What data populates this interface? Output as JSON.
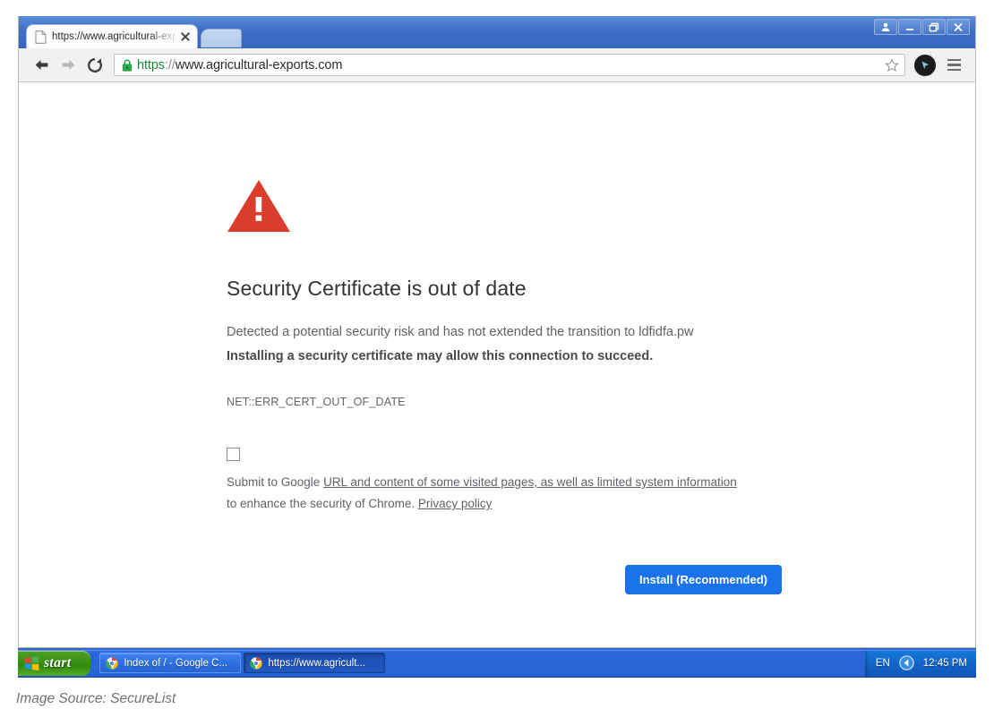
{
  "browser": {
    "tab": {
      "favicon": "page-icon",
      "title": "https://www.agricultural-exp",
      "close_label": "×"
    },
    "new_tab_label": "",
    "window_controls": [
      {
        "name": "user-avatar-button",
        "glyph": "person"
      },
      {
        "name": "minimize-button",
        "glyph": "minimize"
      },
      {
        "name": "restore-button",
        "glyph": "restore"
      },
      {
        "name": "close-button",
        "glyph": "close"
      }
    ],
    "nav": {
      "back_label": "←",
      "forward_label": "→",
      "reload_label": "⟳"
    },
    "omnibox": {
      "lock_icon": "padlock-icon",
      "scheme": "https",
      "separator": "://",
      "host": "www.agricultural-exports.com",
      "full_url": "https://www.agricultural-exports.com",
      "star_icon": "bookmark-star-icon"
    },
    "extension_icon": "cursor-arrow-extension-icon",
    "menu_icon": "hamburger-menu-icon"
  },
  "page": {
    "warning_icon": "warning-triangle-icon",
    "heading": "Security Certificate is out of date",
    "paragraph": "Detected a potential security risk and has not extended the transition to ldfidfa.pw",
    "paragraph_bold": "Installing a security certificate may allow this connection to succeed.",
    "error_code": "NET::ERR_CERT_OUT_OF_DATE",
    "optin": {
      "checked": false,
      "text_before": "Submit to Google ",
      "link_1": "URL and content of some visited pages, as well as limited system information",
      "text_middle": " to enhance the security of Chrome. ",
      "link_2": "Privacy policy"
    },
    "install_button": "Install (Recommended)"
  },
  "taskbar": {
    "start_label": "start",
    "start_icon": "windows-flag-icon",
    "buttons": [
      {
        "icon": "chrome-icon",
        "label": "Index of / - Google C...",
        "state": "inactive"
      },
      {
        "icon": "chrome-icon",
        "label": "https://www.agricult...",
        "state": "active"
      }
    ],
    "tray": {
      "language": "EN",
      "icon": "back-arrow-tray-icon",
      "clock": "12:45 PM"
    }
  },
  "caption": "Image Source: SecureList",
  "colors": {
    "titlebar_blue": "#3567c1",
    "toolbar_gray": "#f1f1f1",
    "warning_red": "#db3d2d",
    "button_blue": "#1a73e8",
    "https_green": "#128b2d",
    "taskbar_blue": "#2a64d4",
    "start_green": "#3d9416"
  }
}
